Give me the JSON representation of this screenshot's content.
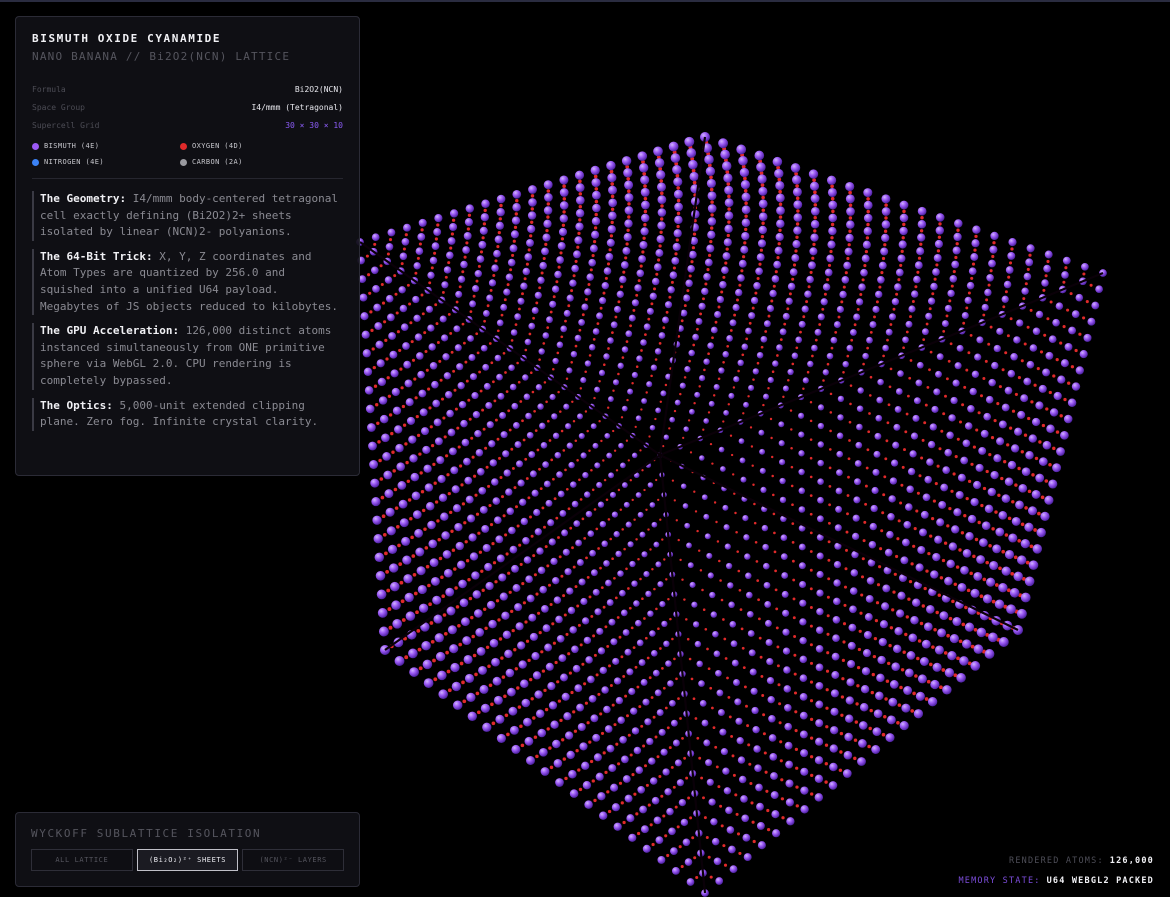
{
  "info": {
    "title": "BISMUTH OXIDE CYANAMIDE",
    "subtitle": "NANO BANANA // Bi2O2(NCN) LATTICE",
    "properties": [
      {
        "key": "Formula",
        "value": "Bi2O2(NCN)"
      },
      {
        "key": "Space Group",
        "value": "I4/mmm (Tetragonal)"
      },
      {
        "key": "Supercell Grid",
        "value": "30 × 30 × 10"
      }
    ],
    "legend": [
      {
        "label": "BISMUTH (4E)",
        "color": "#9b59f5"
      },
      {
        "label": "OXYGEN (4D)",
        "color": "#e02a2a"
      },
      {
        "label": "NITROGEN (4E)",
        "color": "#3b82f6"
      },
      {
        "label": "CARBON (2A)",
        "color": "#9a9aa0"
      }
    ],
    "notes": [
      {
        "head": "The Geometry:",
        "body": " I4/mmm body-centered tetragonal cell exactly defining (Bi2O2)2+ sheets isolated by linear (NCN)2- polyanions."
      },
      {
        "head": "The 64-Bit Trick:",
        "body": " X, Y, Z coordinates and Atom Types are quantized by 256.0 and squished into a unified U64 payload. Megabytes of JS objects reduced to kilobytes."
      },
      {
        "head": "The GPU Acceleration:",
        "body": " 126,000 distinct atoms instanced simultaneously from ONE primitive sphere via WebGL 2.0. CPU rendering is completely bypassed."
      },
      {
        "head": "The Optics:",
        "body": " 5,000-unit extended clipping plane. Zero fog. Infinite crystal clarity."
      }
    ]
  },
  "wyckoff": {
    "title": "WYCKOFF SUBLATTICE ISOLATION",
    "buttons": [
      {
        "label": "ALL LATTICE",
        "active": false
      },
      {
        "label": "(Bi₂O₂)²⁺ SHEETS",
        "active": true
      },
      {
        "label": "(NCN)²⁻ LAYERS",
        "active": false
      }
    ]
  },
  "stats": {
    "rendered_label": "RENDERED ATOMS:",
    "rendered_value": "126,000",
    "memory_label": "MEMORY STATE:",
    "memory_value": "U64 WEBGL2 PACKED"
  },
  "colors": {
    "bismuth": "#9b59f5",
    "oxygen": "#e02a2a",
    "accent": "#8b5cf6",
    "background": "#000000"
  }
}
